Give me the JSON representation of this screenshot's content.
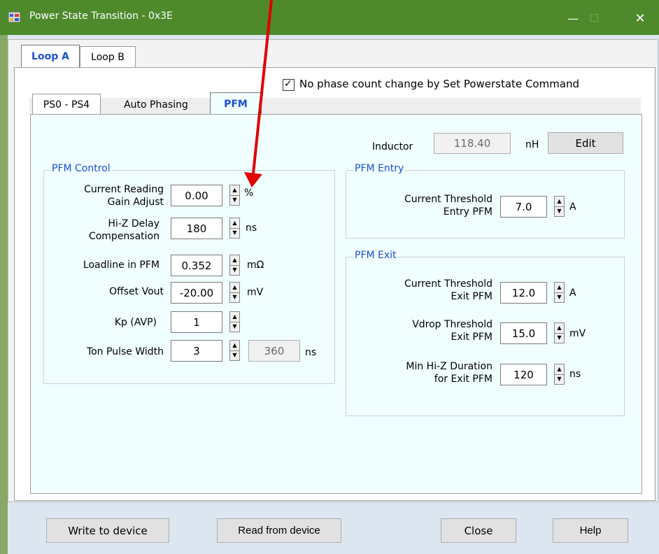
{
  "window": {
    "title": "Power State Transition - 0x3E",
    "minimize_symbol": "—",
    "maximize_symbol": "☐",
    "close_symbol": "✕"
  },
  "outer_tabs": [
    {
      "label": "Loop A",
      "active": true
    },
    {
      "label": "Loop B",
      "active": false
    }
  ],
  "no_phase_change": {
    "label": "No phase count change by Set Powerstate Command",
    "checked": true,
    "check_symbol": "✓"
  },
  "inner_tabs": [
    {
      "label": "PS0 - PS4",
      "active": false
    },
    {
      "label": "Auto Phasing",
      "active": false
    },
    {
      "label": "PFM",
      "active": true
    }
  ],
  "inductor": {
    "label": "Inductor",
    "value": "118.40",
    "unit": "nH",
    "edit_label": "Edit"
  },
  "pfm_control": {
    "title": "PFM Control",
    "current_gain": {
      "label_line1": "Current Reading",
      "label_line2": "Gain Adjust",
      "value": "0.00",
      "unit": "%"
    },
    "hiz_delay": {
      "label_line1": "Hi-Z Delay",
      "label_line2": "Compensation",
      "value": "180",
      "unit": "ns"
    },
    "loadline": {
      "label": "Loadline in PFM",
      "value": "0.352",
      "unit": "mΩ"
    },
    "offset_vout": {
      "label": "Offset Vout",
      "value": "-20.00",
      "unit": "mV"
    },
    "kp": {
      "label": "Kp (AVP)",
      "value": "1"
    },
    "ton": {
      "label": "Ton Pulse Width",
      "value": "3",
      "readonly_value": "360",
      "unit": "ns"
    }
  },
  "pfm_entry": {
    "title": "PFM Entry",
    "current_threshold": {
      "label_line1": "Current Threshold",
      "label_line2": "Entry PFM",
      "value": "7.0",
      "unit": "A"
    }
  },
  "pfm_exit": {
    "title": "PFM Exit",
    "current_threshold": {
      "label_line1": "Current Threshold",
      "label_line2": "Exit PFM",
      "value": "12.0",
      "unit": "A"
    },
    "vdrop_threshold": {
      "label_line1": "Vdrop Threshold",
      "label_line2": "Exit PFM",
      "value": "15.0",
      "unit": "mV"
    },
    "min_hiz": {
      "label_line1": "Min Hi-Z Duration",
      "label_line2": "for Exit PFM",
      "value": "120",
      "unit": "ns"
    }
  },
  "buttons": {
    "write": "Write to device",
    "read": "Read from device",
    "close": "Close",
    "help": "Help"
  },
  "colors": {
    "titlebar": "#4e8a2c",
    "panel_bg": "#f0feff",
    "group_title": "#1a4fd1",
    "annotation_arrow": "#e00000"
  }
}
